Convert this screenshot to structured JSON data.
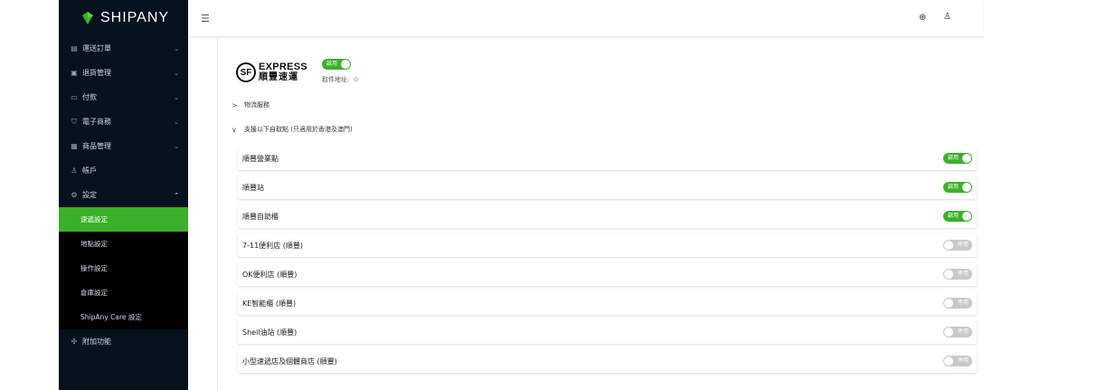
{
  "brand": {
    "name": "SHIPANY"
  },
  "sidebar": {
    "items": [
      {
        "label": "運送訂單",
        "icon": "orders-icon",
        "glyph": "▤",
        "chevron": "⌄"
      },
      {
        "label": "退貨管理",
        "icon": "returns-icon",
        "glyph": "▣",
        "chevron": "⌄"
      },
      {
        "label": "付款",
        "icon": "payment-icon",
        "glyph": "▭",
        "chevron": "⌄"
      },
      {
        "label": "電子商務",
        "icon": "cart-icon",
        "glyph": "⛉",
        "chevron": "⌄"
      },
      {
        "label": "商品管理",
        "icon": "products-icon",
        "glyph": "▦",
        "chevron": "⌄"
      },
      {
        "label": "帳戶",
        "icon": "user-icon",
        "glyph": "♙",
        "chevron": ""
      },
      {
        "label": "設定",
        "icon": "settings-icon",
        "glyph": "⚙",
        "chevron": "⌃"
      }
    ],
    "settings_sub": [
      {
        "label": "速遞設定",
        "active": true
      },
      {
        "label": "地點設定",
        "active": false
      },
      {
        "label": "操作設定",
        "active": false
      },
      {
        "label": "倉庫設定",
        "active": false
      },
      {
        "label": "ShipAny Care 設定",
        "active": false
      }
    ],
    "addons": {
      "label": "附加功能",
      "icon": "addons-icon",
      "glyph": "✣"
    }
  },
  "topbar": {
    "menu_glyph": "☰",
    "globe_glyph": "⊕",
    "user_glyph": "♙"
  },
  "carrier": {
    "logo_mark": "SF",
    "logo_en": "EXPRESS",
    "logo_cn": "順豐速運",
    "status_label": "啟用",
    "pickup_address_label": "取件地址:",
    "pin_glyph": "⊙"
  },
  "sections": {
    "logistics": {
      "label": "物流服務",
      "arrow": ">"
    },
    "pickup_points": {
      "label": "支援以下自取點 (只適用於香港及澳門)",
      "arrow": "∨"
    }
  },
  "pickup_points": [
    {
      "label": "順豐營業點",
      "enabled": true,
      "status": "啟用"
    },
    {
      "label": "順豐站",
      "enabled": true,
      "status": "啟用"
    },
    {
      "label": "順豐自助櫃",
      "enabled": true,
      "status": "啟用"
    },
    {
      "label": "7-11便利店 (順豐)",
      "enabled": false,
      "status": "停用"
    },
    {
      "label": "OK便利店 (順豐)",
      "enabled": false,
      "status": "停用"
    },
    {
      "label": "KE智能櫃 (順豐)",
      "enabled": false,
      "status": "停用"
    },
    {
      "label": "Shell油站 (順豐)",
      "enabled": false,
      "status": "停用"
    },
    {
      "label": "小型速遞店及個體商店 (順豐)",
      "enabled": false,
      "status": "停用"
    }
  ],
  "colors": {
    "accent": "#3bb02a",
    "sidebar_bg": "#06111e",
    "switch_off": "#c9c9c9"
  }
}
